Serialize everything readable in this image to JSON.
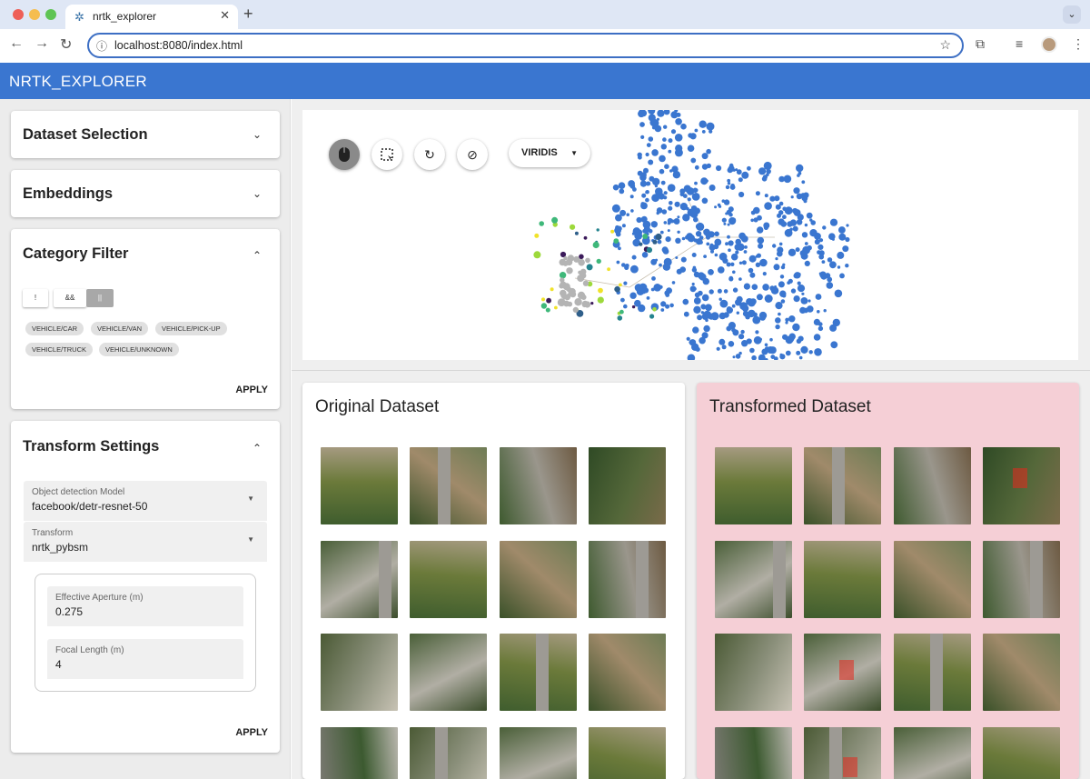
{
  "browser": {
    "tab_title": "nrtk_explorer",
    "url": "localhost:8080/index.html",
    "new_tab": "+",
    "close": "✕"
  },
  "app": {
    "title": "NRTK_EXPLORER"
  },
  "sidebar": {
    "dataset_selection": {
      "title": "Dataset Selection"
    },
    "embeddings": {
      "title": "Embeddings"
    },
    "category_filter": {
      "title": "Category Filter",
      "toggles": [
        "!",
        "&&",
        "||"
      ],
      "chips": [
        "VEHICLE/CAR",
        "VEHICLE/VAN",
        "VEHICLE/PICK-UP",
        "VEHICLE/TRUCK",
        "VEHICLE/UNKNOWN"
      ],
      "apply": "APPLY"
    },
    "transform_settings": {
      "title": "Transform Settings",
      "model_label": "Object detection Model",
      "model_value": "facebook/detr-resnet-50",
      "transform_label": "Transform",
      "transform_value": "nrtk_pybsm",
      "aperture_label": "Effective Aperture (m)",
      "aperture_value": "0.275",
      "focal_label": "Focal Length (m)",
      "focal_value": "4",
      "apply": "APPLY"
    }
  },
  "scatter": {
    "tools": [
      "mouse-icon",
      "box-select-icon",
      "refresh-icon",
      "hide-icon"
    ],
    "colormap": "VIRIDIS",
    "colors": {
      "primary": "#3a76d0",
      "viridis": [
        "#3b1a5a",
        "#2f5f8a",
        "#25838e",
        "#3fb87a",
        "#9dd93b",
        "#f0e22a"
      ],
      "neutral": "#b4b4b4"
    }
  },
  "original": {
    "title": "Original Dataset"
  },
  "transformed": {
    "title": "Transformed Dataset",
    "background": "#f5cfd6"
  }
}
